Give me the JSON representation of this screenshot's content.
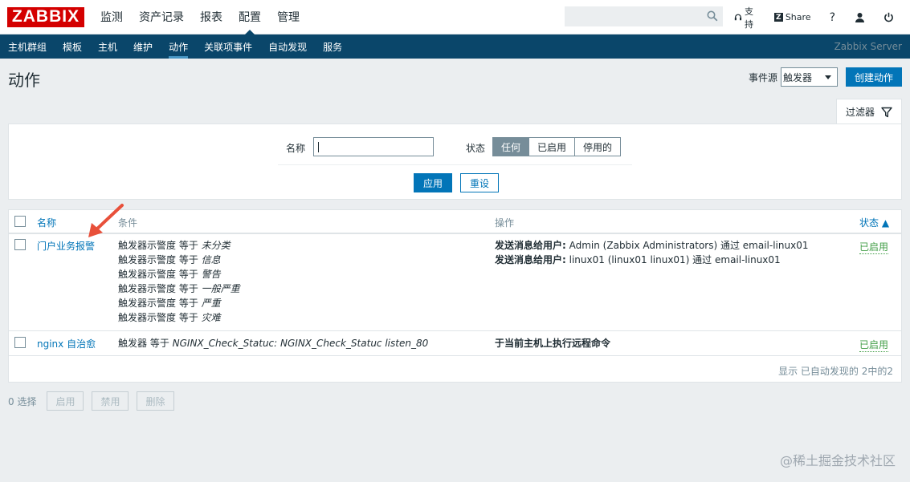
{
  "brand": "ZABBIX",
  "main_menu": [
    "监测",
    "资产记录",
    "报表",
    "配置",
    "管理"
  ],
  "top_links": {
    "support": "支持",
    "share": "Share",
    "help": "?"
  },
  "sub_menu": [
    "主机群组",
    "模板",
    "主机",
    "维护",
    "动作",
    "关联项事件",
    "自动发现",
    "服务"
  ],
  "server_name": "Zabbix Server",
  "page": {
    "title": "动作",
    "event_source_label": "事件源",
    "event_source_value": "触发器",
    "create_button": "创建动作"
  },
  "filter": {
    "tab_label": "过滤器",
    "name_label": "名称",
    "name_value": "",
    "status_label": "状态",
    "status_options": [
      "任何",
      "已启用",
      "停用的"
    ],
    "apply_button": "应用",
    "reset_button": "重设"
  },
  "table": {
    "headers": {
      "name": "名称",
      "conditions": "条件",
      "operations": "操作",
      "status": "状态 ▲"
    },
    "rows": [
      {
        "name": "门户业务报警",
        "conditions": [
          {
            "text": "触发器示警度 等于 ",
            "value": "未分类"
          },
          {
            "text": "触发器示警度 等于 ",
            "value": "信息"
          },
          {
            "text": "触发器示警度 等于 ",
            "value": "警告"
          },
          {
            "text": "触发器示警度 等于 ",
            "value": "一般严重"
          },
          {
            "text": "触发器示警度 等于 ",
            "value": "严重"
          },
          {
            "text": "触发器示警度 等于 ",
            "value": "灾难"
          }
        ],
        "operations": [
          {
            "bold": "发送消息给用户:",
            "rest": " Admin (Zabbix Administrators) 通过 email-linux01"
          },
          {
            "bold": "发送消息给用户:",
            "rest": " linux01 (linux01 linux01) 通过 email-linux01"
          }
        ],
        "status": "已启用"
      },
      {
        "name": "nginx 自治愈",
        "conditions": [
          {
            "text": "触发器 等于 ",
            "value": "NGINX_Check_Statuc: NGINX_Check_Statuc listen_80"
          }
        ],
        "operations": [
          {
            "bold": "于当前主机上执行远程命令",
            "rest": ""
          }
        ],
        "status": "已启用"
      }
    ],
    "footer": "显示 已自动发现的 2中的2"
  },
  "bottom": {
    "selected": "0 选择",
    "enable": "启用",
    "disable": "禁用",
    "delete": "删除"
  },
  "watermark": "@稀土掘金技术社区",
  "colors": {
    "brand_red": "#d40000",
    "nav_blue": "#0a466a",
    "link_blue": "#0275b8",
    "status_green": "#429e47",
    "arrow_red": "#e8503a"
  }
}
